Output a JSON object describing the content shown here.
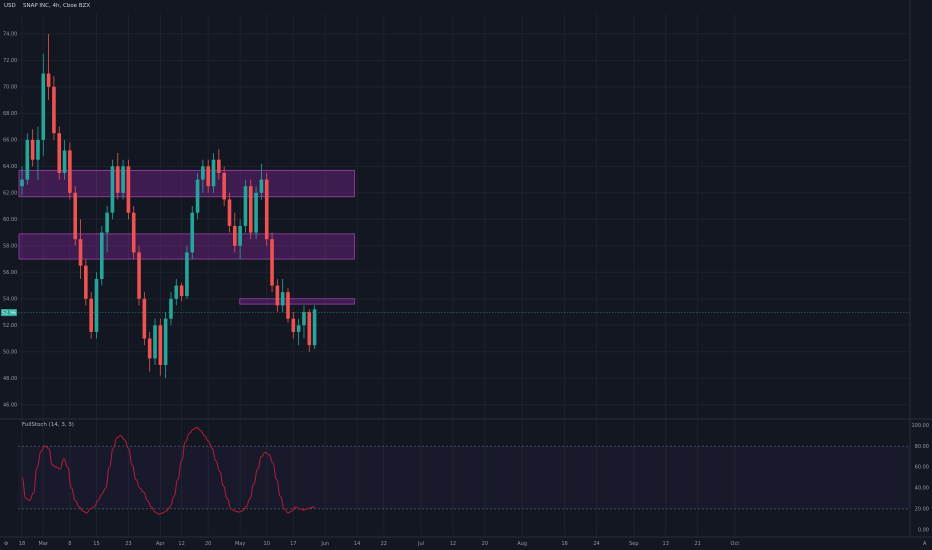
{
  "header": {
    "currency": "USD",
    "symbol_line": "SNAP INC, 4h, Cboe BZX"
  },
  "indicator": {
    "label": "FullStoch (14, 3, 3)"
  },
  "last_price_label": "52.96",
  "colors": {
    "background": "#131722",
    "up": "#26a69a",
    "down": "#ef5350",
    "zone_fill": "#9c27b0",
    "osc_line": "#b71c3c",
    "grid": "#1e222d",
    "axis_text": "#9598a1",
    "price_tag": "#26a69a"
  },
  "chart_data": {
    "type": "candlestick",
    "title": "SNAP INC, 4h, Cboe BZX",
    "price_axis": {
      "ticks": [
        "46.00",
        "48.00",
        "50.00",
        "52.00",
        "54.00",
        "56.00",
        "58.00",
        "60.00",
        "62.00",
        "64.00",
        "66.00",
        "68.00",
        "70.00",
        "72.00",
        "74.00"
      ],
      "range": [
        45.0,
        75.5
      ]
    },
    "oscillator_axis": {
      "ticks": [
        "0.00",
        "20.00",
        "40.00",
        "60.00",
        "80.00",
        "100.00"
      ],
      "range": [
        -5,
        105
      ],
      "levels": [
        20,
        80
      ]
    },
    "time_axis": {
      "labels": [
        "18",
        "Mar",
        "8",
        "15",
        "23",
        "Apr",
        "12",
        "20",
        "May",
        "10",
        "17",
        "Jun",
        "14",
        "22",
        "Jul",
        "12",
        "20",
        "Aug",
        "16",
        "24",
        "Sep",
        "13",
        "21",
        "Oct"
      ],
      "label_index": [
        0,
        4,
        9,
        14,
        20,
        26,
        30,
        35,
        41,
        46,
        51,
        57,
        63,
        68,
        75,
        81,
        87,
        94,
        102,
        108,
        115,
        121,
        127,
        134
      ]
    },
    "last_price": 52.96,
    "zones": [
      {
        "from_index": 0,
        "to_index": 62.5,
        "low": 61.7,
        "high": 63.7
      },
      {
        "from_index": 0,
        "to_index": 62.5,
        "low": 57.0,
        "high": 58.9
      },
      {
        "from_index": 41.5,
        "to_index": 62.5,
        "low": 53.6,
        "high": 54.0
      }
    ],
    "candles": [
      [
        62.5,
        64.0,
        61.8,
        63.0
      ],
      [
        63.0,
        66.5,
        62.6,
        66.0
      ],
      [
        66.0,
        66.8,
        64.0,
        64.5
      ],
      [
        64.5,
        67.0,
        63.0,
        66.0
      ],
      [
        66.0,
        72.5,
        64.8,
        71.0
      ],
      [
        71.0,
        74.0,
        69.0,
        70.0
      ],
      [
        70.0,
        70.8,
        66.0,
        66.5
      ],
      [
        66.5,
        67.0,
        63.0,
        63.5
      ],
      [
        63.5,
        66.0,
        63.0,
        65.2
      ],
      [
        65.2,
        65.8,
        61.5,
        62.0
      ],
      [
        62.0,
        62.5,
        58.0,
        58.5
      ],
      [
        58.5,
        60.0,
        55.5,
        56.5
      ],
      [
        56.5,
        57.0,
        53.5,
        54.0
      ],
      [
        54.0,
        54.5,
        51.0,
        51.5
      ],
      [
        51.5,
        56.0,
        51.0,
        55.5
      ],
      [
        55.5,
        59.5,
        55.0,
        59.0
      ],
      [
        59.0,
        61.0,
        57.5,
        60.5
      ],
      [
        60.5,
        64.5,
        60.0,
        64.0
      ],
      [
        64.0,
        65.0,
        61.5,
        62.0
      ],
      [
        62.0,
        64.5,
        61.5,
        64.0
      ],
      [
        64.0,
        64.5,
        60.0,
        60.5
      ],
      [
        60.5,
        61.0,
        57.0,
        57.5
      ],
      [
        57.5,
        58.0,
        53.5,
        54.0
      ],
      [
        54.0,
        54.5,
        50.5,
        51.0
      ],
      [
        51.0,
        51.5,
        48.5,
        49.5
      ],
      [
        49.5,
        52.5,
        49.0,
        52.0
      ],
      [
        52.0,
        52.5,
        48.2,
        49.0
      ],
      [
        49.0,
        53.0,
        48.0,
        52.5
      ],
      [
        52.5,
        54.5,
        52.0,
        54.0
      ],
      [
        54.0,
        55.5,
        53.5,
        55.0
      ],
      [
        55.0,
        55.2,
        53.8,
        54.2
      ],
      [
        54.2,
        58.0,
        54.0,
        57.5
      ],
      [
        57.5,
        61.0,
        57.0,
        60.5
      ],
      [
        60.5,
        63.5,
        60.0,
        63.0
      ],
      [
        63.0,
        64.5,
        62.0,
        64.0
      ],
      [
        64.0,
        64.5,
        62.0,
        62.5
      ],
      [
        62.5,
        65.0,
        62.0,
        64.5
      ],
      [
        64.5,
        65.3,
        63.0,
        63.5
      ],
      [
        63.5,
        64.0,
        61.0,
        61.5
      ],
      [
        61.5,
        62.0,
        59.0,
        59.5
      ],
      [
        59.5,
        60.5,
        57.5,
        58.0
      ],
      [
        58.0,
        60.0,
        57.0,
        59.5
      ],
      [
        59.5,
        63.0,
        59.0,
        62.5
      ],
      [
        62.5,
        63.0,
        58.5,
        59.0
      ],
      [
        59.0,
        62.5,
        58.5,
        62.0
      ],
      [
        62.0,
        64.2,
        61.5,
        63.0
      ],
      [
        63.0,
        63.5,
        58.0,
        58.5
      ],
      [
        58.5,
        59.0,
        54.5,
        55.0
      ],
      [
        55.0,
        55.5,
        53.0,
        53.5
      ],
      [
        53.5,
        55.5,
        53.0,
        54.5
      ],
      [
        54.5,
        54.8,
        52.2,
        52.5
      ],
      [
        52.5,
        53.0,
        51.0,
        51.5
      ],
      [
        51.5,
        52.5,
        50.5,
        52.0
      ],
      [
        52.0,
        53.5,
        51.0,
        53.0
      ],
      [
        53.0,
        53.2,
        50.0,
        50.5
      ],
      [
        50.5,
        53.5,
        50.2,
        53.2
      ]
    ],
    "oscillator": [
      50,
      30,
      28,
      35,
      60,
      75,
      80,
      78,
      62,
      60,
      58,
      68,
      60,
      40,
      28,
      22,
      18,
      16,
      20,
      22,
      28,
      34,
      40,
      60,
      78,
      88,
      90,
      86,
      78,
      62,
      48,
      40,
      36,
      28,
      22,
      17,
      15,
      16,
      18,
      22,
      32,
      48,
      66,
      84,
      92,
      96,
      98,
      95,
      90,
      85,
      78,
      66,
      56,
      42,
      30,
      20,
      18,
      17,
      18,
      22,
      30,
      44,
      58,
      70,
      74,
      72,
      64,
      48,
      32,
      20,
      16,
      18,
      22,
      20,
      19,
      20,
      21,
      22
    ]
  }
}
